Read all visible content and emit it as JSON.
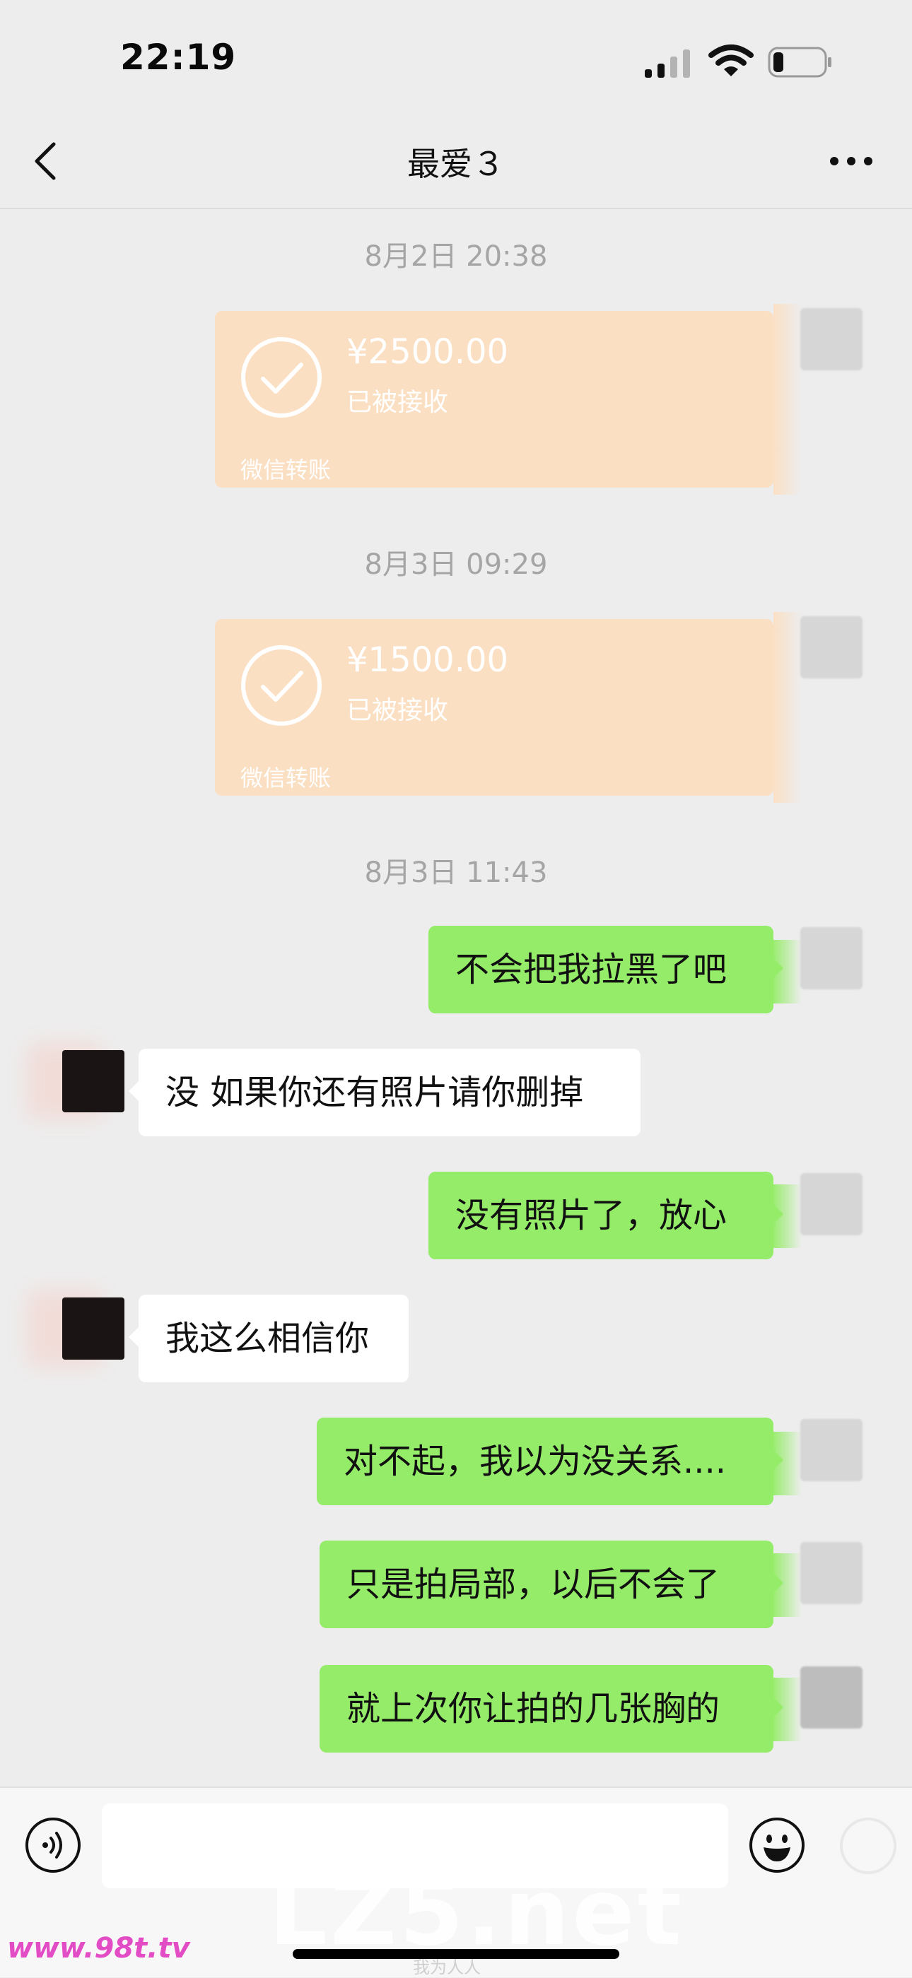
{
  "status_bar": {
    "time": "22:19",
    "signal_icon": "signal-icon",
    "wifi_icon": "wifi-icon",
    "battery_icon": "battery-icon"
  },
  "header": {
    "title": "最爱３",
    "back_icon": "chevron-left-icon",
    "more_icon": "more-icon"
  },
  "messages": {
    "ts1": "8月2日 20:38",
    "transfer1": {
      "amount": "¥2500.00",
      "status": "已被接收",
      "label": "微信转账"
    },
    "ts2": "8月3日 09:29",
    "transfer2": {
      "amount": "¥1500.00",
      "status": "已被接收",
      "label": "微信转账"
    },
    "ts3": "8月3日 11:43",
    "m1": "不会把我拉黑了吧",
    "m2": "没 如果你还有照片请你删掉",
    "m3": "没有照片了，放心",
    "m4": "我这么相信你",
    "m5": "对不起，我以为没关系....",
    "m6": "只是拍局部，以后不会了",
    "m7": "就上次你让拍的几张胸的"
  },
  "input_bar": {
    "voice_icon": "voice-icon",
    "emoji_icon": "emoji-icon",
    "plus_icon": "plus-icon",
    "input_value": ""
  },
  "watermarks": {
    "main": "LZ5.net",
    "corner": "www.98t.tv",
    "small": "我为人人"
  },
  "colors": {
    "background": "#ededed",
    "my_bubble": "#95ec69",
    "their_bubble": "#ffffff",
    "transfer_card": "#fbdfc3",
    "timestamp": "#a5a5a5"
  }
}
